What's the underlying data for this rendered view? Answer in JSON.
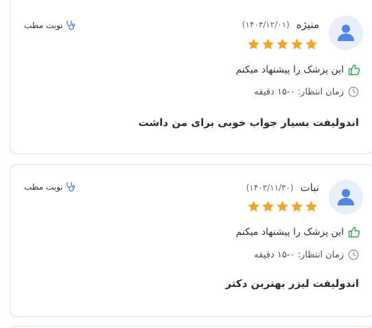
{
  "reviews": [
    {
      "name": "منیژه",
      "date": "(۱۴۰۳/۱۲/۰۱)",
      "rating": 5,
      "visit_type": "نوبت مطب",
      "recommend_text": "این پزشک را پیشنهاد میکنم",
      "wait_text": "زمان انتظار: ۰-۱۵ دقیقه",
      "comment": "اندولیفت بسیار جواب خوبی برای من داشت"
    },
    {
      "name": "نبات",
      "date": "(۱۴۰۳/۱۱/۳۰)",
      "rating": 5,
      "visit_type": "نوبت مطب",
      "recommend_text": "این پزشک را پیشنهاد میکنم",
      "wait_text": "زمان انتظار: ۰-۱۵ دقیقه",
      "comment": "اندولیفت لیزر بهترین دکتر"
    }
  ],
  "colors": {
    "star": "#f5a524",
    "thumb": "#2fa84f",
    "avatar_bg": "#e8effb",
    "avatar_fg": "#4f86e8",
    "stethoscope": "#4f86e8"
  },
  "icons": {
    "avatar": "user-icon",
    "star": "star-icon",
    "recommend": "thumbs-up-icon",
    "wait": "clock-icon",
    "visit": "stethoscope-icon"
  }
}
